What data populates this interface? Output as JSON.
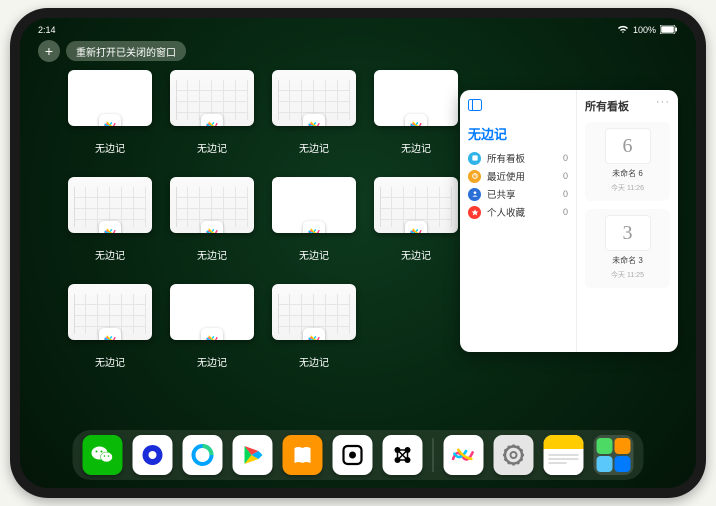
{
  "status": {
    "time": "2:14",
    "battery_text": "100%"
  },
  "top_buttons": {
    "plus": "+",
    "reopen_label": "重新打开已关闭的窗口"
  },
  "windows": [
    {
      "label": "无边记",
      "style": "blank"
    },
    {
      "label": "无边记",
      "style": "cal"
    },
    {
      "label": "无边记",
      "style": "cal"
    },
    {
      "label": "无边记",
      "style": "blank"
    },
    {
      "label": "无边记",
      "style": "cal"
    },
    {
      "label": "无边记",
      "style": "cal"
    },
    {
      "label": "无边记",
      "style": "blank"
    },
    {
      "label": "无边记",
      "style": "cal"
    },
    {
      "label": "无边记",
      "style": "cal"
    },
    {
      "label": "无边记",
      "style": "blank"
    },
    {
      "label": "无边记",
      "style": "cal"
    }
  ],
  "panel": {
    "title": "无边记",
    "right_title": "所有看板",
    "more": "···",
    "items": [
      {
        "label": "所有看板",
        "count": "0",
        "color": "#2fb3e8"
      },
      {
        "label": "最近使用",
        "count": "0",
        "color": "#f5a623"
      },
      {
        "label": "已共享",
        "count": "0",
        "color": "#2a6fd6"
      },
      {
        "label": "个人收藏",
        "count": "0",
        "color": "#ff3b30"
      }
    ],
    "boards": [
      {
        "name": "未命名 6",
        "date": "今天 11:26",
        "glyph": "6"
      },
      {
        "name": "未命名 3",
        "date": "今天 11:25",
        "glyph": "3"
      }
    ]
  },
  "dock": {
    "icons": [
      {
        "name": "wechat-icon",
        "bg": "#09bb07",
        "glyph": "wechat"
      },
      {
        "name": "quark-icon",
        "bg": "#ffffff",
        "glyph": "quark"
      },
      {
        "name": "qqbrowser-icon",
        "bg": "#ffffff",
        "glyph": "qqbrowser"
      },
      {
        "name": "play-icon",
        "bg": "#ffffff",
        "glyph": "play"
      },
      {
        "name": "books-icon",
        "bg": "#ff9500",
        "glyph": "books"
      },
      {
        "name": "dice-icon",
        "bg": "#ffffff",
        "glyph": "dice"
      },
      {
        "name": "connect-icon",
        "bg": "#ffffff",
        "glyph": "connect"
      },
      {
        "name": "freeform-icon",
        "bg": "#ffffff",
        "glyph": "freeform"
      },
      {
        "name": "settings-icon",
        "bg": "#e5e5e5",
        "glyph": "gear"
      },
      {
        "name": "notes-icon",
        "bg": "#fff",
        "glyph": "notes"
      }
    ]
  }
}
